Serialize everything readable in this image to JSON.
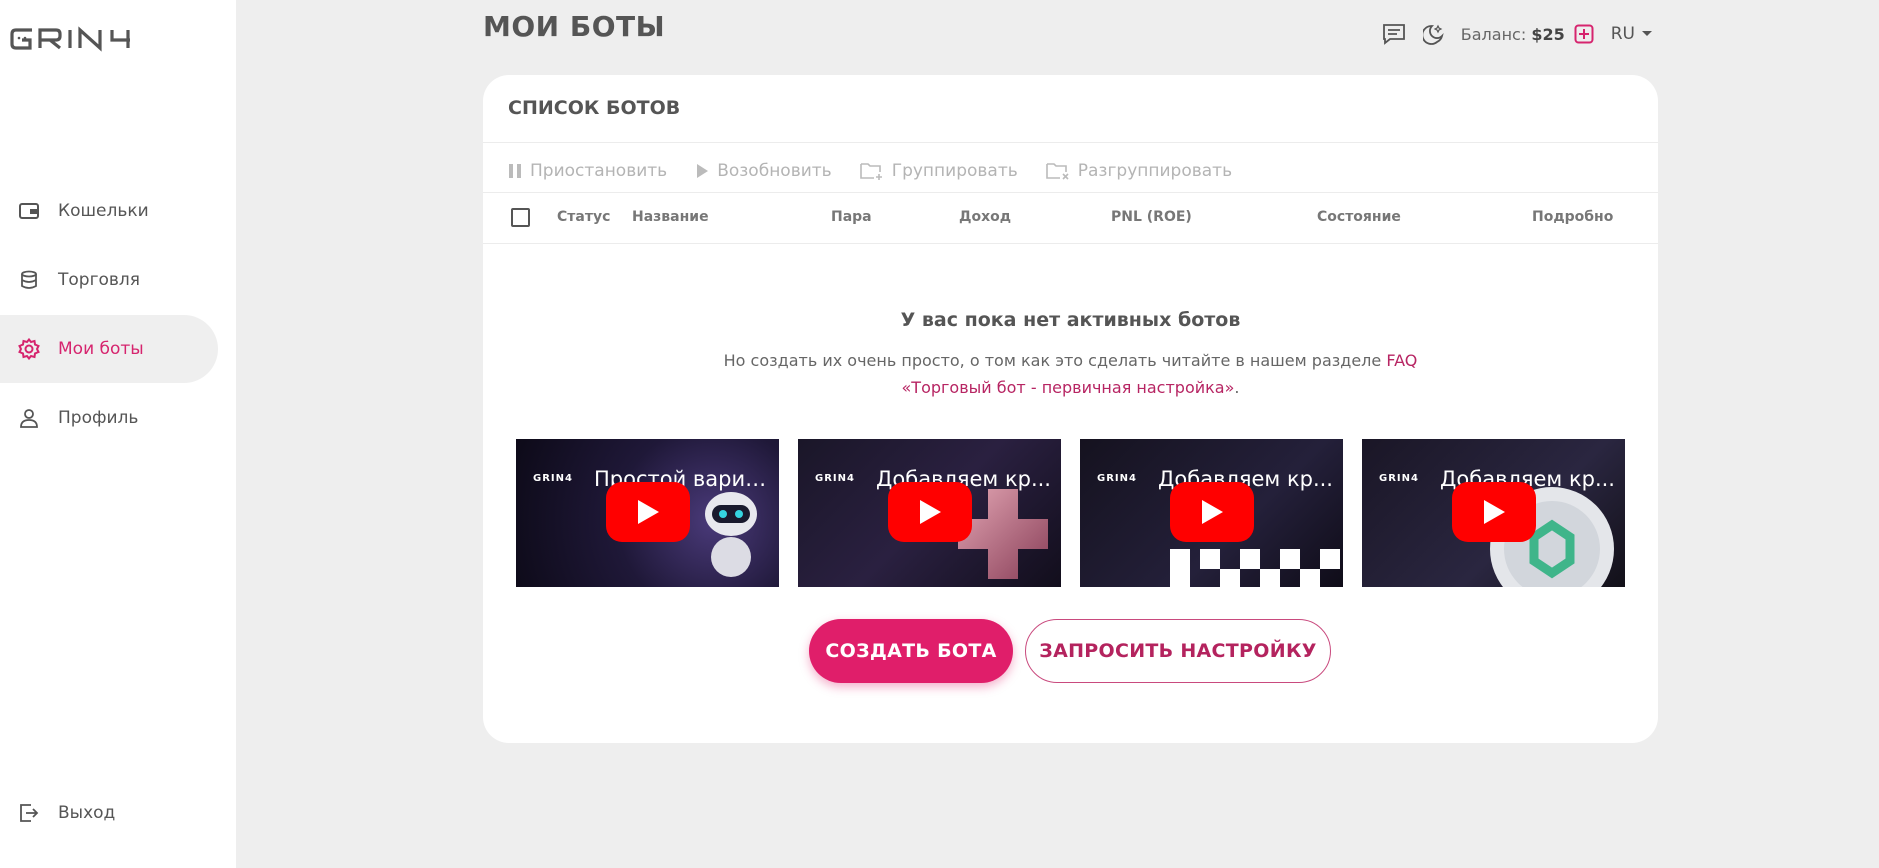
{
  "brand": {
    "logo_text": "GRIN4",
    "accent_color": "#e01e6a"
  },
  "sidebar": {
    "items": [
      {
        "label": "Кошельки",
        "icon": "wallet-icon"
      },
      {
        "label": "Торговля",
        "icon": "database-icon"
      },
      {
        "label": "Мои боты",
        "icon": "gear-icon",
        "active": true
      },
      {
        "label": "Профиль",
        "icon": "user-icon"
      }
    ],
    "logout_label": "Выход"
  },
  "header": {
    "title": "МОИ БОТЫ",
    "balance_label": "Баланс:",
    "balance_value": "$25",
    "language": "RU"
  },
  "card": {
    "title": "СПИСОК БОТОВ",
    "toolbar": {
      "pause": "Приостановить",
      "resume": "Возобновить",
      "group": "Группировать",
      "ungroup": "Разгруппировать"
    },
    "columns": [
      "Статус",
      "Название",
      "Пара",
      "Доход",
      "PNL (ROE)",
      "Состояние",
      "Подробно"
    ],
    "empty": {
      "title": "У вас пока нет активных ботов",
      "text": "Но создать их очень просто, о том как это сделать читайте в нашем разделе",
      "link_faq": "FAQ",
      "link_guide": "«Торговый бот - первичная настройка»",
      "text_end": "."
    },
    "videos": [
      {
        "title": "Простой вариант...",
        "channel": "GRIN4"
      },
      {
        "title": "Добавляем кр...",
        "channel": "GRIN4"
      },
      {
        "title": "Добавляем кр...",
        "channel": "GRIN4"
      },
      {
        "title": "Добавляем кр...",
        "channel": "GRIN4"
      }
    ],
    "create_button": "СОЗДАТЬ БОТА",
    "request_button": "ЗАПРОСИТЬ НАСТРОЙКУ"
  }
}
